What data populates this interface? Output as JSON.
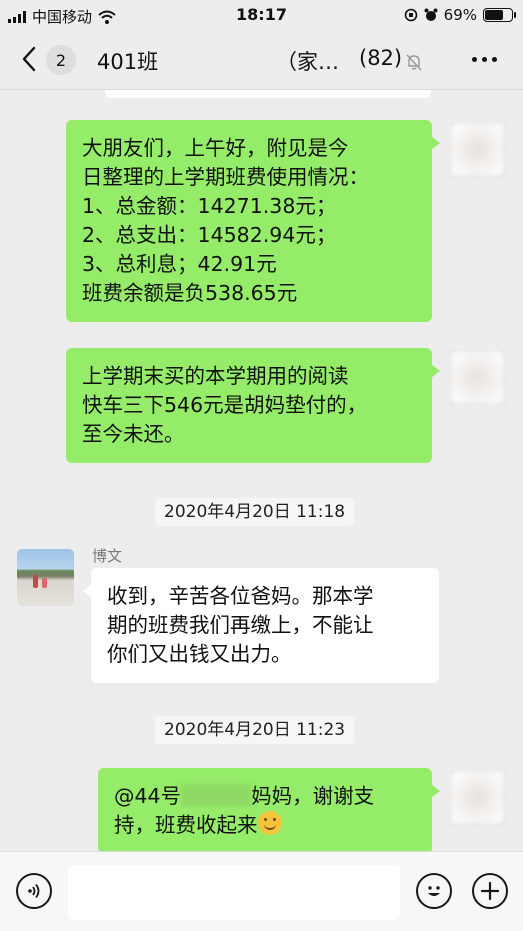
{
  "status_bar": {
    "carrier": "中国移动",
    "time": "18:17",
    "battery": "69%",
    "battery_level": 0.69
  },
  "nav": {
    "back_icon": "chevron-left-icon",
    "unread_badge": "2",
    "title_prefix": "401班",
    "title_suffix": "（家…",
    "member_count": "(82)",
    "mute_icon": "bell-muted-icon",
    "more_icon": "more-dots-icon"
  },
  "messages": [
    {
      "side": "right",
      "lines": [
        "大朋友们，上午好，附见是今",
        "日整理的上学期班费使用情况：",
        "1、总金额：14271.38元；",
        "2、总支出：14582.94元；",
        "3、总利息；42.91元",
        "班费余额是负538.65元"
      ]
    },
    {
      "side": "right",
      "lines": [
        "上学期末买的本学期用的阅读",
        "快车三下546元是胡妈垫付的，",
        "至今未还。"
      ]
    },
    {
      "timestamp": "2020年4月20日 11:18"
    },
    {
      "side": "left",
      "sender": "博文",
      "lines": [
        "收到，辛苦各位爸妈。那本学",
        "期的班费我们再缴上，不能让",
        "你们又出钱又出力。"
      ]
    },
    {
      "timestamp": "2020年4月20日 11:23"
    },
    {
      "side": "right",
      "line1_start": "@44号",
      "line1_end": "妈妈，谢谢支",
      "line2": "持，班费收起来",
      "emoji": "smile-emoji-icon"
    }
  ],
  "input_bar": {
    "voice_icon": "voice-icon",
    "emoji_icon": "emoji-icon",
    "plus_icon": "plus-icon",
    "input_value": ""
  },
  "colors": {
    "background": "#ededed",
    "outgoing_bubble": "#95ec69",
    "incoming_bubble": "#ffffff"
  }
}
